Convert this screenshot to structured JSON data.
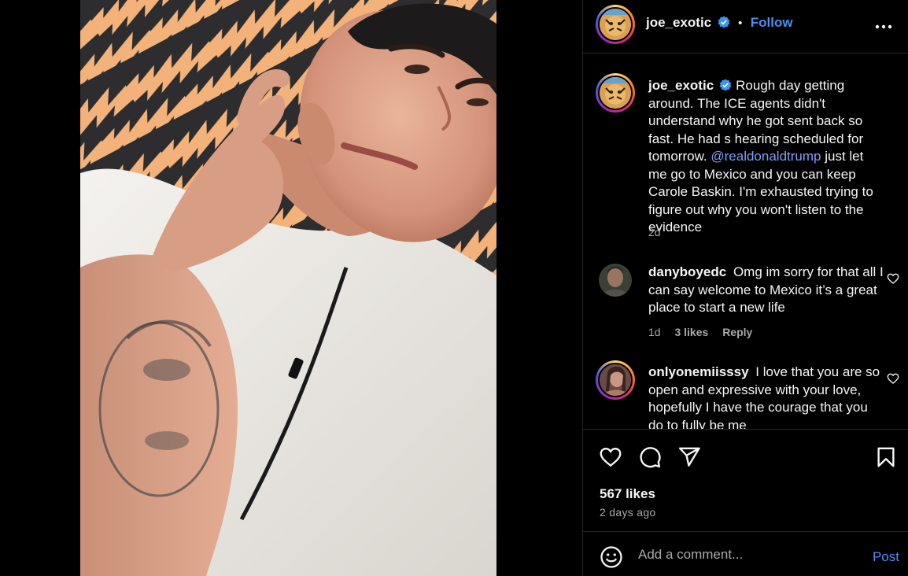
{
  "post": {
    "author": "joe_exotic",
    "follow_label": "Follow",
    "separator": "•",
    "caption": {
      "username": "joe_exotic",
      "text_before": "Rough day getting around. The ICE agents didn't understand why he got sent back so fast. He had s hearing scheduled for tomorrow.",
      "mention": "@realdonaldtrump",
      "text_after": "just let me go to Mexico and you can keep Carole Baskin. I'm exhausted trying to figure out why you won't listen to the evidence",
      "age": "2d"
    },
    "comments": [
      {
        "username": "danyboyedc",
        "text": "Omg im sorry for that all I can say welcome to Mexico it’s a great place to start a new life",
        "age": "1d",
        "likes": "3 likes",
        "reply_label": "Reply"
      },
      {
        "username": "onlyonemiisssy",
        "text": "I love that you are so open and expressive with your love, hopefully I have the courage that you do to fully be me"
      }
    ],
    "likes": "567 likes",
    "posted": "2 days ago",
    "add_comment_placeholder": "Add a comment...",
    "post_label": "Post"
  },
  "colors": {
    "background": "#000000",
    "accent": "#4e8df5",
    "mention": "#7c9ef7",
    "muted_text": "#a8a8a8",
    "divider": "#262626",
    "flame_pattern": "#f2b27a"
  },
  "icons": [
    "verified-badge-icon",
    "more-options-icon",
    "like-heart-icon",
    "comment-icon",
    "share-icon",
    "save-bookmark-icon",
    "emoji-icon",
    "small-heart-icon"
  ]
}
